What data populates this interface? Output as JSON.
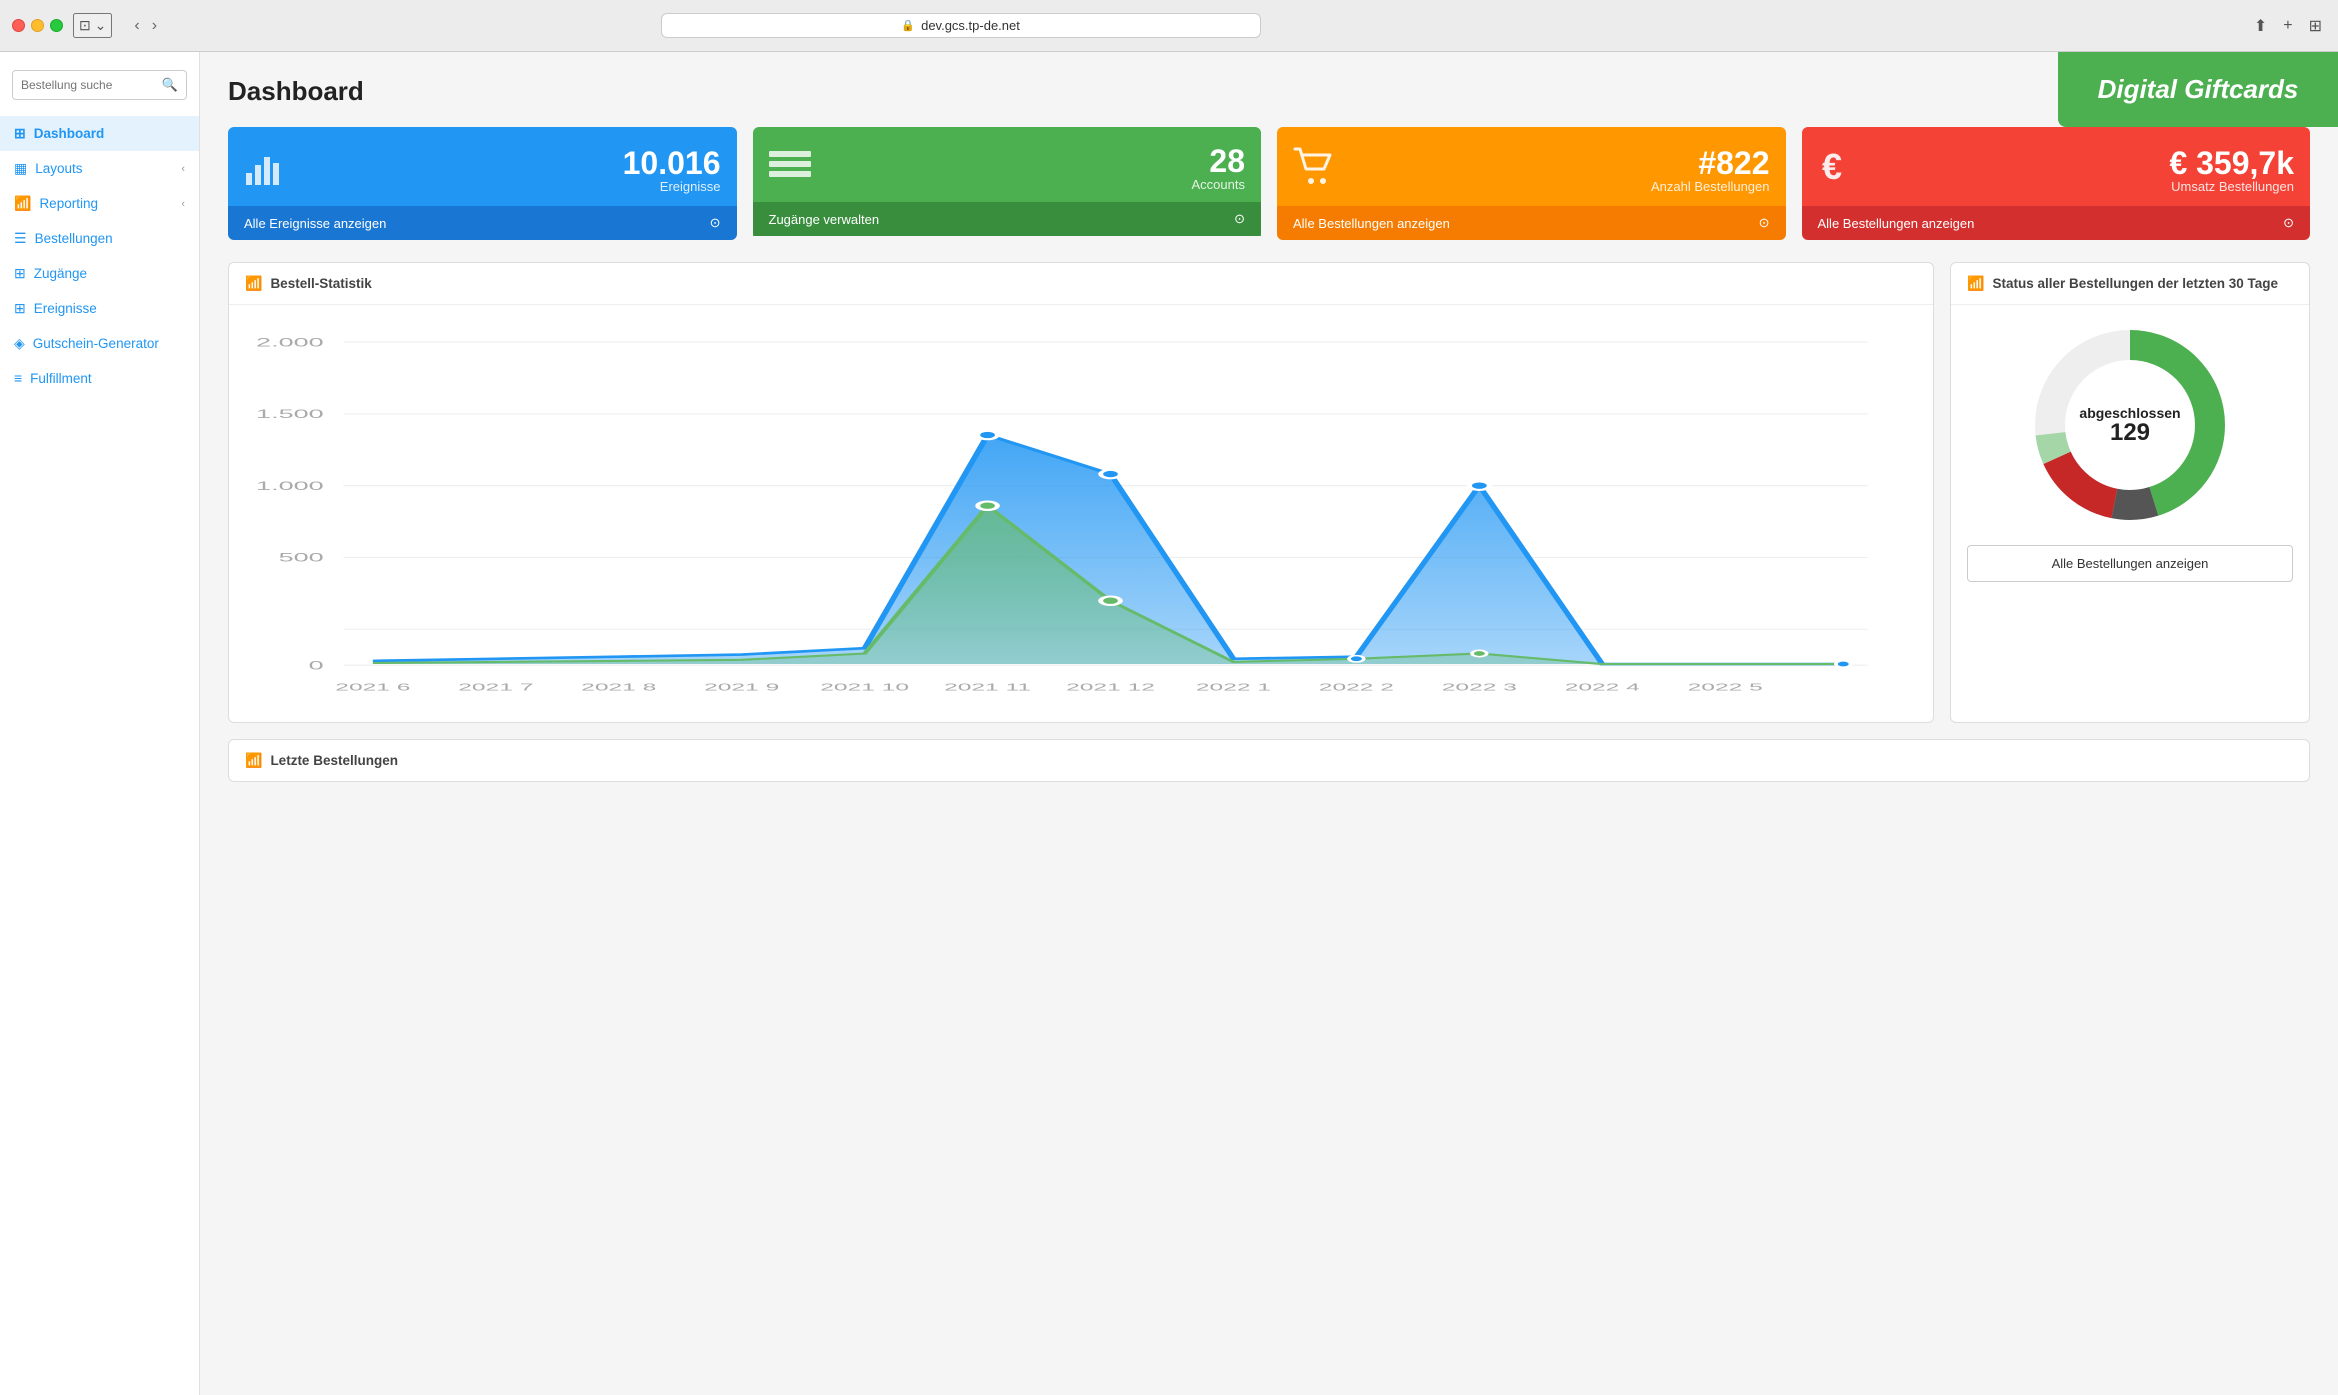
{
  "browser": {
    "url": "dev.gcs.tp-de.net",
    "lock_icon": "🔒"
  },
  "search": {
    "placeholder": "Bestellung suche"
  },
  "sidebar": {
    "items": [
      {
        "id": "dashboard",
        "label": "Dashboard",
        "icon": "⊞",
        "active": true,
        "has_chevron": false
      },
      {
        "id": "layouts",
        "label": "Layouts",
        "icon": "▦",
        "active": false,
        "has_chevron": true
      },
      {
        "id": "reporting",
        "label": "Reporting",
        "icon": "📊",
        "active": false,
        "has_chevron": true
      },
      {
        "id": "bestellungen",
        "label": "Bestellungen",
        "icon": "☰",
        "active": false,
        "has_chevron": false
      },
      {
        "id": "zugaenge",
        "label": "Zugänge",
        "icon": "⊞",
        "active": false,
        "has_chevron": false
      },
      {
        "id": "ereignisse",
        "label": "Ereignisse",
        "icon": "⊞",
        "active": false,
        "has_chevron": false
      },
      {
        "id": "gutschein",
        "label": "Gutschein-Generator",
        "icon": "⊞",
        "active": false,
        "has_chevron": false
      },
      {
        "id": "fulfillment",
        "label": "Fulfillment",
        "icon": "≡",
        "active": false,
        "has_chevron": false
      }
    ]
  },
  "page": {
    "title": "Dashboard"
  },
  "stat_cards": [
    {
      "color": "blue",
      "icon": "📊",
      "number": "10.016",
      "label": "Ereignisse",
      "link_text": "Alle Ereignisse anzeigen",
      "link_icon": "→"
    },
    {
      "color": "green",
      "icon": "≡",
      "number": "28",
      "label": "Accounts",
      "link_text": "Zugänge verwalten",
      "link_icon": "→"
    },
    {
      "color": "orange",
      "icon": "🛒",
      "number": "#822",
      "label": "Anzahl Bestellungen",
      "link_text": "Alle Bestellungen anzeigen",
      "link_icon": "→"
    },
    {
      "color": "red",
      "icon": "€",
      "number": "€ 359,7k",
      "label": "Umsatz Bestellungen",
      "link_text": "Alle Bestellungen anzeigen",
      "link_icon": "→"
    }
  ],
  "bestell_statistik": {
    "title": "Bestell-Statistik",
    "icon": "📊",
    "x_labels": [
      "2021 6",
      "2021 7",
      "2021 8",
      "2021 9",
      "2021 10",
      "2021 11",
      "2021 12",
      "2022 1",
      "2022 2",
      "2022 3",
      "2022 4",
      "2022 5"
    ],
    "y_labels": [
      "2.000",
      "1.500",
      "1.000",
      "500",
      "0"
    ]
  },
  "status_chart": {
    "title": "Status aller Bestellungen der letzten 30 Tage",
    "icon": "📊",
    "center_label": "abgeschlossen",
    "center_value": "129",
    "show_all_label": "Alle Bestellungen anzeigen"
  },
  "letzte_bestellungen": {
    "title": "Letzte Bestellungen",
    "icon": "📊"
  },
  "giftcard": {
    "label": "Digital Giftcards"
  }
}
